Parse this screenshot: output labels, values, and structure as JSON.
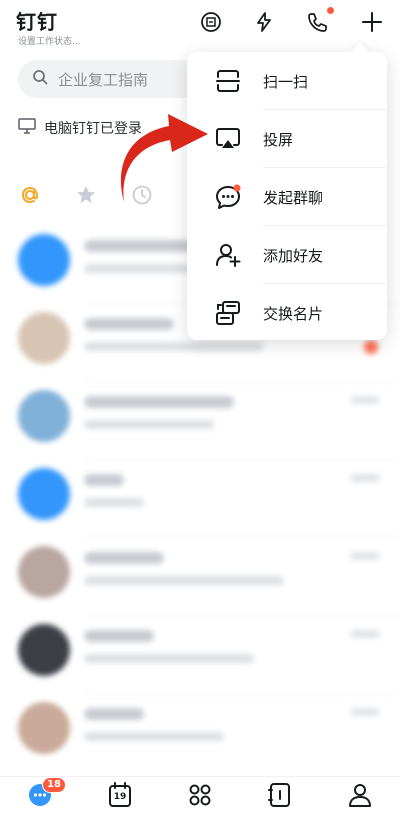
{
  "header": {
    "title": "钉钉",
    "subtitle": "设置工作状态..."
  },
  "search": {
    "placeholder": "企业复工指南"
  },
  "pc_banner": {
    "text": "电脑钉钉已登录"
  },
  "menu": {
    "items": [
      {
        "label": "扫一扫",
        "icon": "scan-icon"
      },
      {
        "label": "投屏",
        "icon": "screen-cast-icon"
      },
      {
        "label": "发起群聊",
        "icon": "group-chat-icon"
      },
      {
        "label": "添加好友",
        "icon": "add-friend-icon"
      },
      {
        "label": "交换名片",
        "icon": "exchange-card-icon"
      }
    ]
  },
  "bottom_nav": {
    "message_badge": "18",
    "calendar_day": "19"
  },
  "colors": {
    "accent": "#ff5a3c",
    "brand_blue": "#3296fa",
    "arrow_red": "#d9271c"
  }
}
